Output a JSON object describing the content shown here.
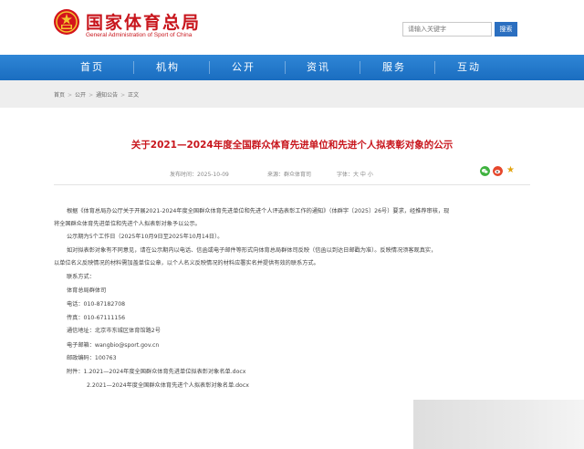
{
  "header": {
    "site_title": "国家体育总局",
    "site_subtitle": "General Administration of Sport of China",
    "search_placeholder": "请输入关键字",
    "search_button": "搜索",
    "colors": {
      "brand_red": "#c8161d",
      "nav_blue": "#1a6dc0",
      "search_blue": "#2b6fc0"
    }
  },
  "nav": {
    "items": [
      {
        "label": "首页"
      },
      {
        "label": "机构"
      },
      {
        "label": "公开"
      },
      {
        "label": "资讯"
      },
      {
        "label": "服务"
      },
      {
        "label": "互动"
      }
    ]
  },
  "breadcrumb": {
    "items": [
      "首页",
      "公开",
      "通知公告",
      "正文"
    ],
    "separator": ">"
  },
  "article": {
    "title": "关于2021—2024年度全国群众体育先进单位和先进个人拟表彰对象的公示",
    "publish_date": "发布时间：2025-10-09",
    "source": "来源：群众体育司",
    "font_size_label": "字体：大 中 小",
    "share_icons": [
      "wechat-icon",
      "weibo-icon",
      "favorite-star-icon"
    ],
    "paragraphs": [
      "根据《体育总局办公厅关于开展2021-2024年度全国群众体育先进单位和先进个人评选表彰工作的通知》（体群字〔2025〕26号）要求，经推荐审核，现",
      "将全国群众体育先进单位和先进个人拟表彰对象予以公示。",
      "公示期为5个工作日（2025年10月9日至2025年10月14日）。",
      "如对拟表彰对象有不同意见，请在公示期内以电话、信函或电子邮件等形式向体育总局群体司反映（信函以到达日邮戳为准）。反映情况须客观真实，",
      "以单位名义反映情况的材料需加盖单位公章，以个人名义反映情况的材料应署实名并提供有效的联系方式。",
      "联系方式：",
      "体育总局群体司",
      "电话：010-87182708",
      "传真：010-67111156",
      "通信地址：北京市东城区体育馆路2号",
      "电子邮箱：wangbio@sport.gov.cn",
      "邮政编码：100763",
      "附件：1.2021—2024年度全国群众体育先进单位拟表彰对象名单.docx",
      "2.2021—2024年度全国群众体育先进个人拟表彰对象名单.docx"
    ]
  }
}
